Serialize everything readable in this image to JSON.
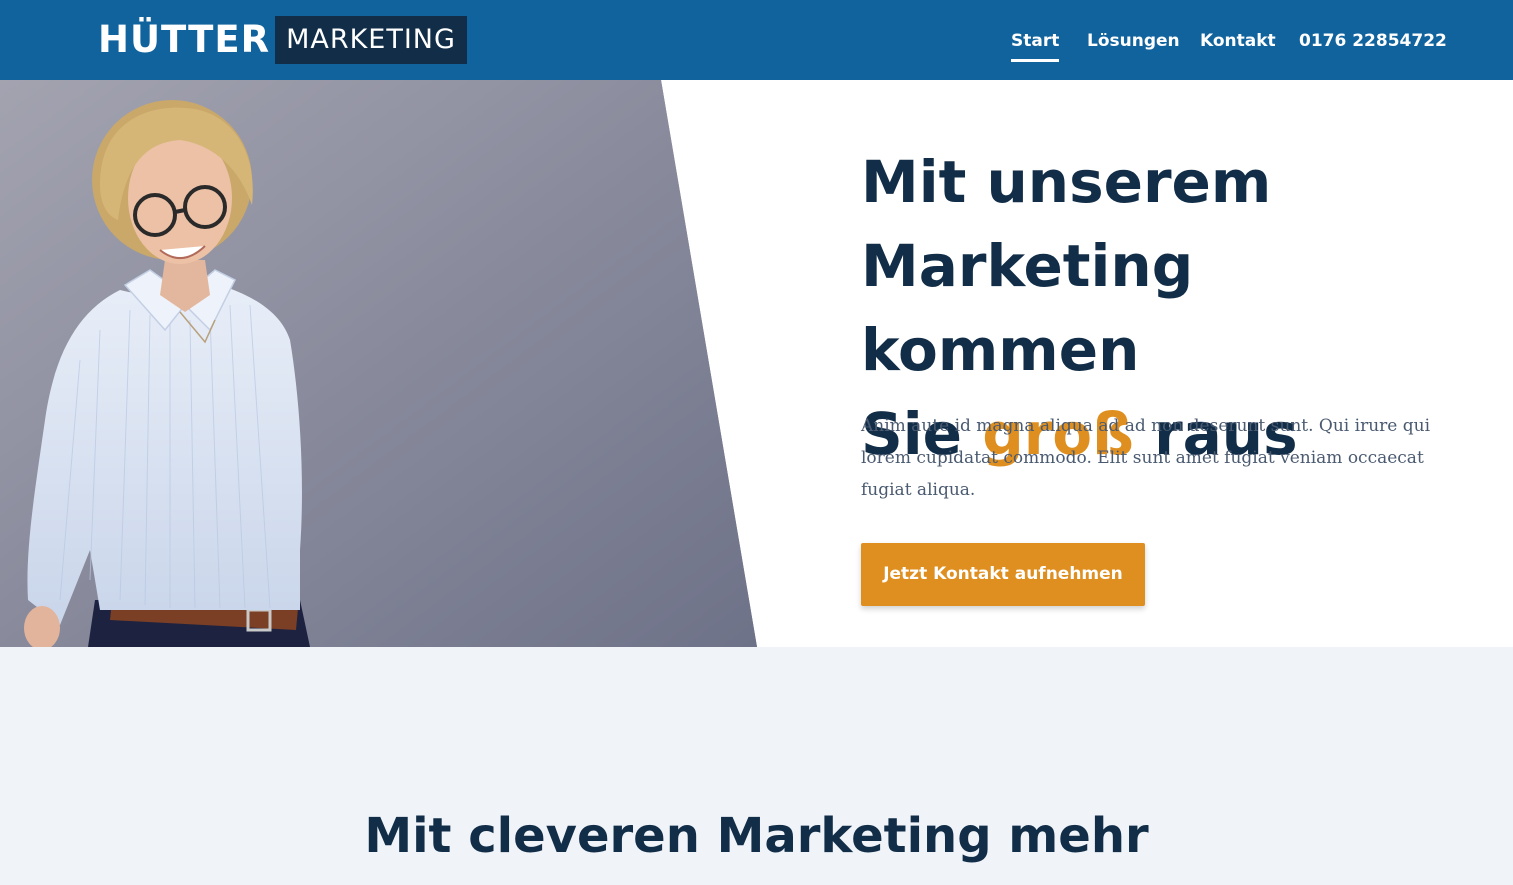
{
  "header": {
    "logo_main": "HÜTTER",
    "logo_box": "MARKETING",
    "nav": [
      {
        "label": "Start",
        "active": true
      },
      {
        "label": "Lösungen",
        "active": false
      },
      {
        "label": "Kontakt",
        "active": false
      },
      {
        "label": "0176 22854722",
        "active": false
      }
    ]
  },
  "hero": {
    "title_line1": "Mit unserem",
    "title_line2": "Marketing kommen",
    "title_line3_pre": "Sie ",
    "title_line3_accent": "groß",
    "title_line3_post": " raus",
    "text": "Anim aute id magna aliqua ad ad non deserunt sunt. Qui irure qui lorem cupidatat commodo. Elit sunt amet fugiat veniam occaecat fugiat aliqua.",
    "cta_label": "Jetzt Kontakt aufnehmen"
  },
  "section2": {
    "title": "Mit cleveren Marketing mehr"
  },
  "colors": {
    "header_bg": "#11639e",
    "logo_box_bg": "#112d47",
    "accent": "#df8f1f",
    "heading": "#112d47",
    "section_bg": "#f0f3f8"
  }
}
